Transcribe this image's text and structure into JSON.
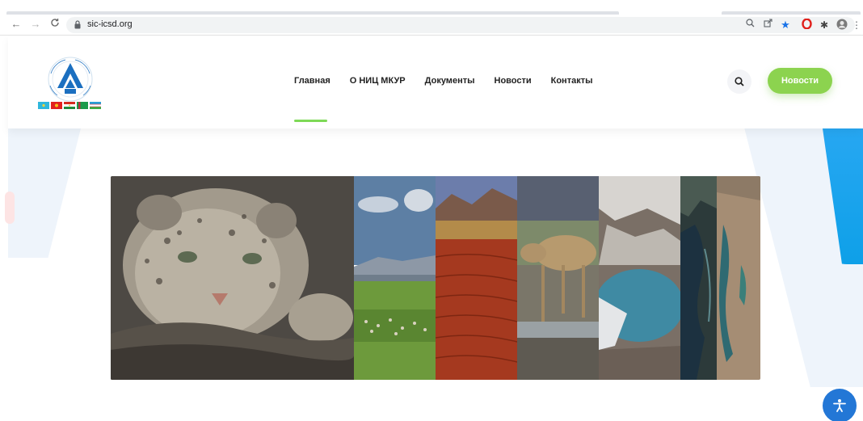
{
  "browser": {
    "url": "sic-icsd.org",
    "nav_icons": [
      "back-icon",
      "forward-icon",
      "reload-icon"
    ],
    "toolbar_icons": [
      "zoom-icon",
      "share-icon",
      "bookmark-star-icon",
      "opera-icon",
      "extensions-icon",
      "profile-icon",
      "kebab-menu-icon"
    ]
  },
  "header": {
    "menu": [
      {
        "label": "Главная",
        "active": true
      },
      {
        "label": "О НИЦ МКУР",
        "active": false
      },
      {
        "label": "Документы",
        "active": false
      },
      {
        "label": "Новости",
        "active": false
      },
      {
        "label": "Контакты",
        "active": false
      }
    ],
    "news_button": "Новости"
  },
  "colors": {
    "accent_green": "#8cd34f",
    "active_underline": "#7ed957",
    "deco_blue": "#0ea0e8",
    "a11y_blue": "#2377d6"
  },
  "banner": {
    "panels": [
      "snow-leopard",
      "steppe-with-sheep",
      "red-desert-dunes",
      "saiga-antelope",
      "mountain-glacier-lake",
      "satellite-lake",
      "satellite-aral-sea"
    ]
  }
}
